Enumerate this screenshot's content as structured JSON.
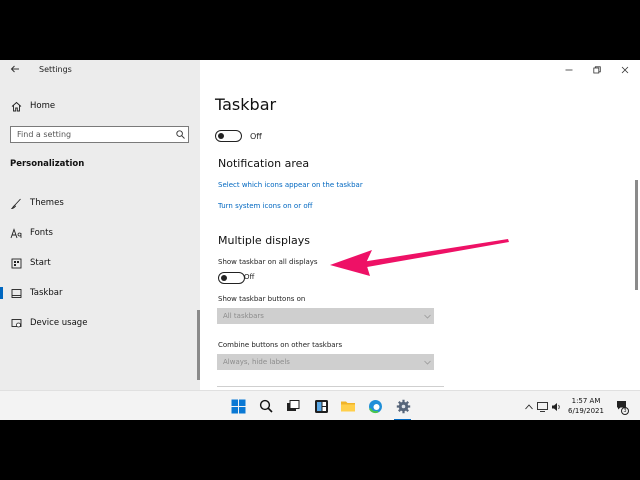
{
  "window": {
    "title": "Settings"
  },
  "sidebar": {
    "home_label": "Home",
    "search_placeholder": "Find a setting",
    "section": "Personalization",
    "items": [
      {
        "label": "Themes",
        "icon": "brush-icon"
      },
      {
        "label": "Fonts",
        "icon": "fonts-icon"
      },
      {
        "label": "Start",
        "icon": "start-icon"
      },
      {
        "label": "Taskbar",
        "icon": "taskbar-icon",
        "active": true
      },
      {
        "label": "Device usage",
        "icon": "device-usage-icon"
      }
    ]
  },
  "content": {
    "title": "Taskbar",
    "top_toggle_state": "Off",
    "notification_area": {
      "heading": "Notification area",
      "link1": "Select which icons appear on the taskbar",
      "link2": "Turn system icons on or off"
    },
    "multiple_displays": {
      "heading": "Multiple displays",
      "show_all_label": "Show taskbar on all displays",
      "show_all_state": "Off",
      "buttons_on_label": "Show taskbar buttons on",
      "buttons_on_value": "All taskbars",
      "combine_label": "Combine buttons on other taskbars",
      "combine_value": "Always, hide labels"
    }
  },
  "annotation": {
    "arrow_color": "#ee1166"
  },
  "taskbar": {
    "icons": [
      "windows-start-icon",
      "search-icon",
      "task-view-icon",
      "widgets-icon",
      "file-explorer-icon",
      "edge-icon",
      "settings-icon"
    ],
    "clock_time": "1:57 AM",
    "clock_date": "6/19/2021",
    "notification_count": "3"
  },
  "colors": {
    "accent": "#0067c0",
    "sidebar_bg": "#ececec"
  }
}
